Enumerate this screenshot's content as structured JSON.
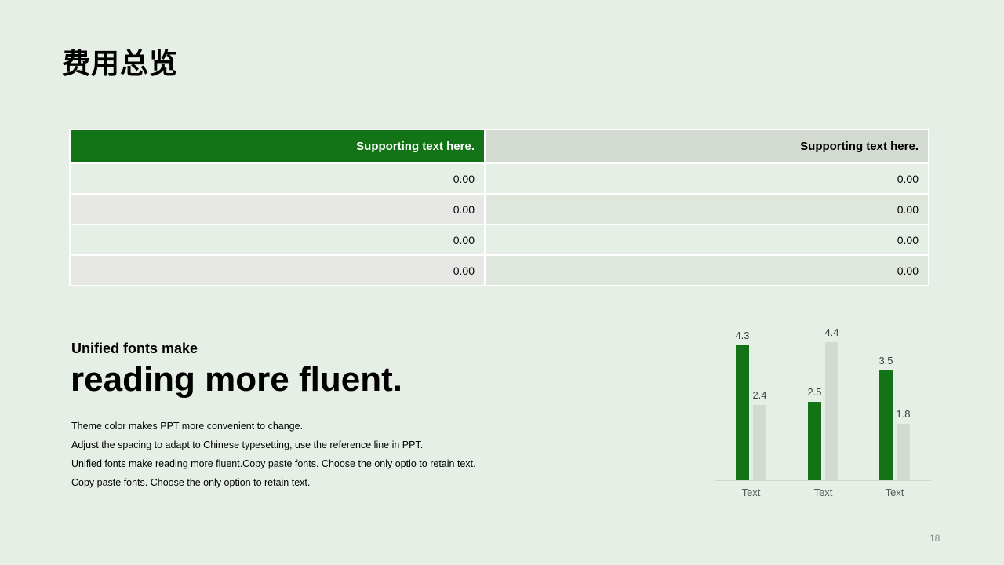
{
  "title": "费用总览",
  "table": {
    "headers": [
      "Supporting text here.",
      "Supporting text here."
    ],
    "rows": [
      [
        "0.00",
        "0.00"
      ],
      [
        "0.00",
        "0.00"
      ],
      [
        "0.00",
        "0.00"
      ],
      [
        "0.00",
        "0.00"
      ]
    ]
  },
  "text_block": {
    "subhead": "Unified fonts make",
    "headline": "reading more fluent.",
    "lines": [
      "Theme color makes PPT more convenient to change.",
      "Adjust the spacing to adapt to Chinese typesetting, use the reference line in PPT.",
      "Unified fonts make reading more fluent.Copy paste fonts. Choose the only optio to retain text.",
      "Copy paste  fonts. Choose the only option to retain text."
    ]
  },
  "chart_data": {
    "type": "bar",
    "categories": [
      "Text",
      "Text",
      "Text"
    ],
    "series": [
      {
        "values": [
          4.3,
          2.5,
          3.5
        ],
        "color": "#137417"
      },
      {
        "values": [
          2.4,
          4.4,
          1.8
        ],
        "color": "#d3dad1"
      }
    ],
    "ylim": [
      0,
      4.5
    ],
    "grid": false,
    "legend": "none"
  },
  "page_number": "18",
  "colors": {
    "background": "#e6efe5",
    "accent": "#137417",
    "secondary": "#d3dad1"
  }
}
